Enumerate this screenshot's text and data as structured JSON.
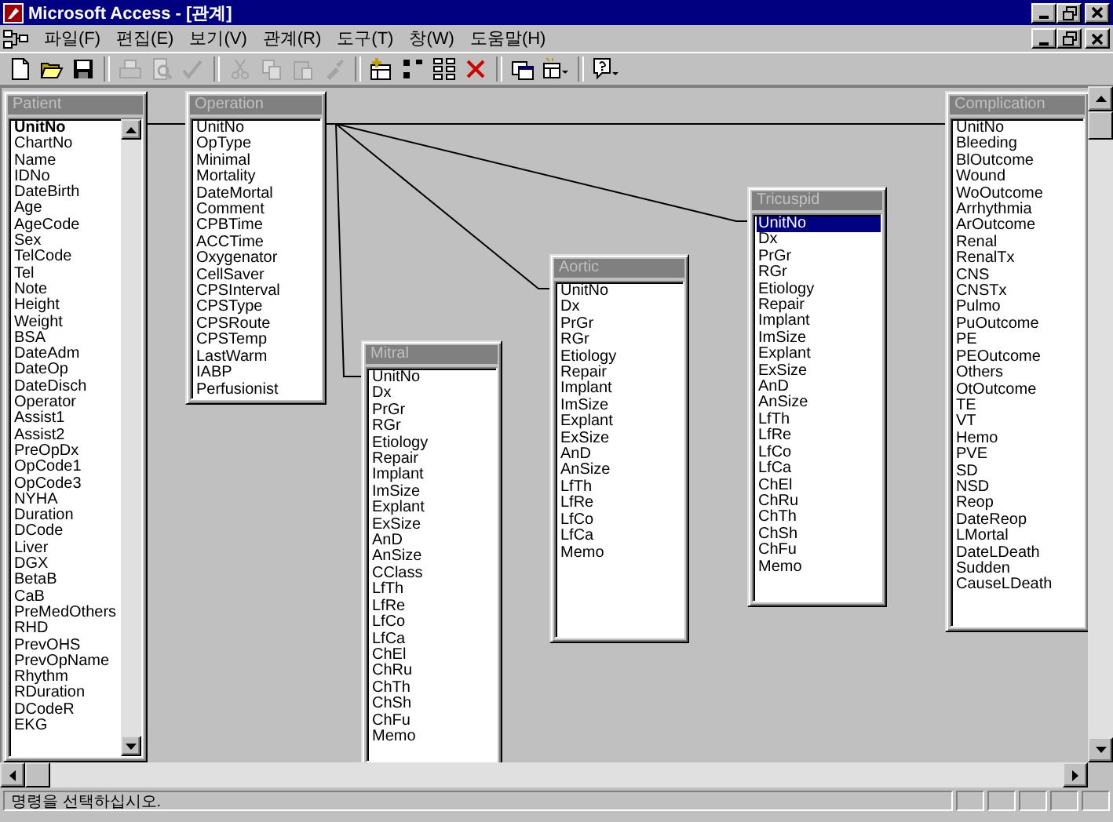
{
  "window": {
    "title": "Microsoft Access - [관계]"
  },
  "menu": [
    "파일(F)",
    "편집(E)",
    "보기(V)",
    "관계(R)",
    "도구(T)",
    "창(W)",
    "도움말(H)"
  ],
  "toolbar_groups": [
    [
      {
        "disabled": false
      },
      {
        "disabled": false
      },
      {
        "disabled": false
      }
    ],
    [
      {
        "disabled": true
      },
      {
        "disabled": true
      },
      {
        "disabled": true
      }
    ],
    [
      {
        "disabled": true
      },
      {
        "disabled": true
      },
      {
        "disabled": true
      },
      {
        "disabled": true
      }
    ],
    [
      {
        "disabled": false
      },
      {
        "disabled": false
      },
      {
        "disabled": false
      },
      {
        "disabled": false
      }
    ],
    [
      {
        "disabled": false
      },
      {
        "disabled": false
      }
    ],
    [
      {
        "disabled": false
      }
    ]
  ],
  "tables": [
    {
      "title": "Patient",
      "header_field": {
        "name": "UnitNo",
        "bold": true,
        "selected": false
      },
      "fields": [
        "ChartNo",
        "Name",
        "IDNo",
        "DateBirth",
        "Age",
        "AgeCode",
        "Sex",
        "TelCode",
        "Tel",
        "Note",
        "Height",
        "Weight",
        "BSA",
        "DateAdm",
        "DateOp",
        "DateDisch",
        "Operator",
        "Assist1",
        "Assist2",
        "PreOpDx",
        "OpCode1",
        "OpCode3",
        "NYHA",
        "Duration",
        "DCode",
        "Liver",
        "DGX",
        "BetaB",
        "CaB",
        "PreMedOthers",
        "RHD",
        "PrevOHS",
        "PrevOpName",
        "Rhythm",
        "RDuration",
        "DCodeR",
        "EKG"
      ]
    },
    {
      "title": "Operation",
      "header_field": {
        "name": "UnitNo",
        "bold": false,
        "selected": false
      },
      "fields": [
        "OpType",
        "Minimal",
        "Mortality",
        "DateMortal",
        "Comment",
        "CPBTime",
        "ACCTime",
        "Oxygenator",
        "CellSaver",
        "CPSInterval",
        "CPSType",
        "CPSRoute",
        "CPSTemp",
        "LastWarm",
        "IABP",
        "Perfusionist"
      ]
    },
    {
      "title": "Mitral",
      "header_field": {
        "name": "UnitNo",
        "bold": false,
        "selected": false
      },
      "fields": [
        "Dx",
        "PrGr",
        "RGr",
        "Etiology",
        "Repair",
        "Implant",
        "ImSize",
        "Explant",
        "ExSize",
        "AnD",
        "AnSize",
        "CClass",
        "LfTh",
        "LfRe",
        "LfCo",
        "LfCa",
        "ChEl",
        "ChRu",
        "ChTh",
        "ChSh",
        "ChFu",
        "Memo"
      ]
    },
    {
      "title": "Aortic",
      "header_field": {
        "name": "UnitNo",
        "bold": false,
        "selected": false
      },
      "fields": [
        "Dx",
        "PrGr",
        "RGr",
        "Etiology",
        "Repair",
        "Implant",
        "ImSize",
        "Explant",
        "ExSize",
        "AnD",
        "AnSize",
        "LfTh",
        "LfRe",
        "LfCo",
        "LfCa",
        "Memo"
      ]
    },
    {
      "title": "Tricuspid",
      "header_field": {
        "name": "UnitNo",
        "bold": false,
        "selected": true
      },
      "fields": [
        "Dx",
        "PrGr",
        "RGr",
        "Etiology",
        "Repair",
        "Implant",
        "ImSize",
        "Explant",
        "ExSize",
        "AnD",
        "AnSize",
        "LfTh",
        "LfRe",
        "LfCo",
        "LfCa",
        "ChEl",
        "ChRu",
        "ChTh",
        "ChSh",
        "ChFu",
        "Memo"
      ]
    },
    {
      "title": "Complication",
      "header_field": {
        "name": "UnitNo",
        "bold": false,
        "selected": false
      },
      "fields": [
        "Bleeding",
        "BlOutcome",
        "Wound",
        "WoOutcome",
        "Arrhythmia",
        "ArOutcome",
        "Renal",
        "RenalTx",
        "CNS",
        "CNSTx",
        "Pulmo",
        "PuOutcome",
        "PE",
        "PEOutcome",
        "Others",
        "OtOutcome",
        "TE",
        "VT",
        "Hemo",
        "PVE",
        "SD",
        "NSD",
        "Reop",
        "DateReop",
        "LMortal",
        "DateLDeath",
        "Sudden",
        "CauseLDeath"
      ]
    }
  ],
  "status_bar": {
    "message": "명령을 선택하십시오."
  }
}
